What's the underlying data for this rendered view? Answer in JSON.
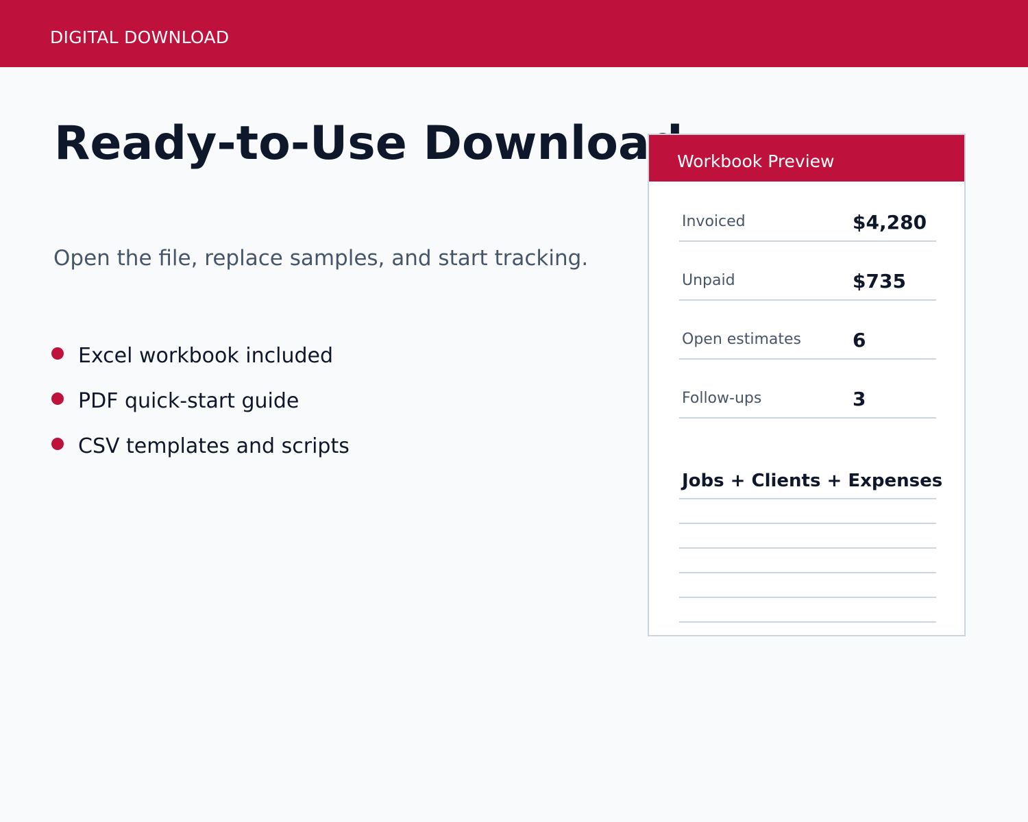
{
  "banner": {
    "label": "DIGITAL DOWNLOAD",
    "color": "#be123c"
  },
  "hero": {
    "title": "Ready-to-Use Download",
    "subtitle": "Open the file, replace samples, and start tracking."
  },
  "features": [
    {
      "text": "Excel workbook included"
    },
    {
      "text": "PDF quick-start guide"
    },
    {
      "text": "CSV templates and scripts"
    }
  ],
  "preview": {
    "title": "Workbook Preview",
    "stats": [
      {
        "label": "Invoiced",
        "value": "$4,280"
      },
      {
        "label": "Unpaid",
        "value": "$735"
      },
      {
        "label": "Open estimates",
        "value": "6"
      },
      {
        "label": "Follow-ups",
        "value": "3"
      }
    ],
    "sheet_title": "Jobs + Clients + Expenses"
  }
}
